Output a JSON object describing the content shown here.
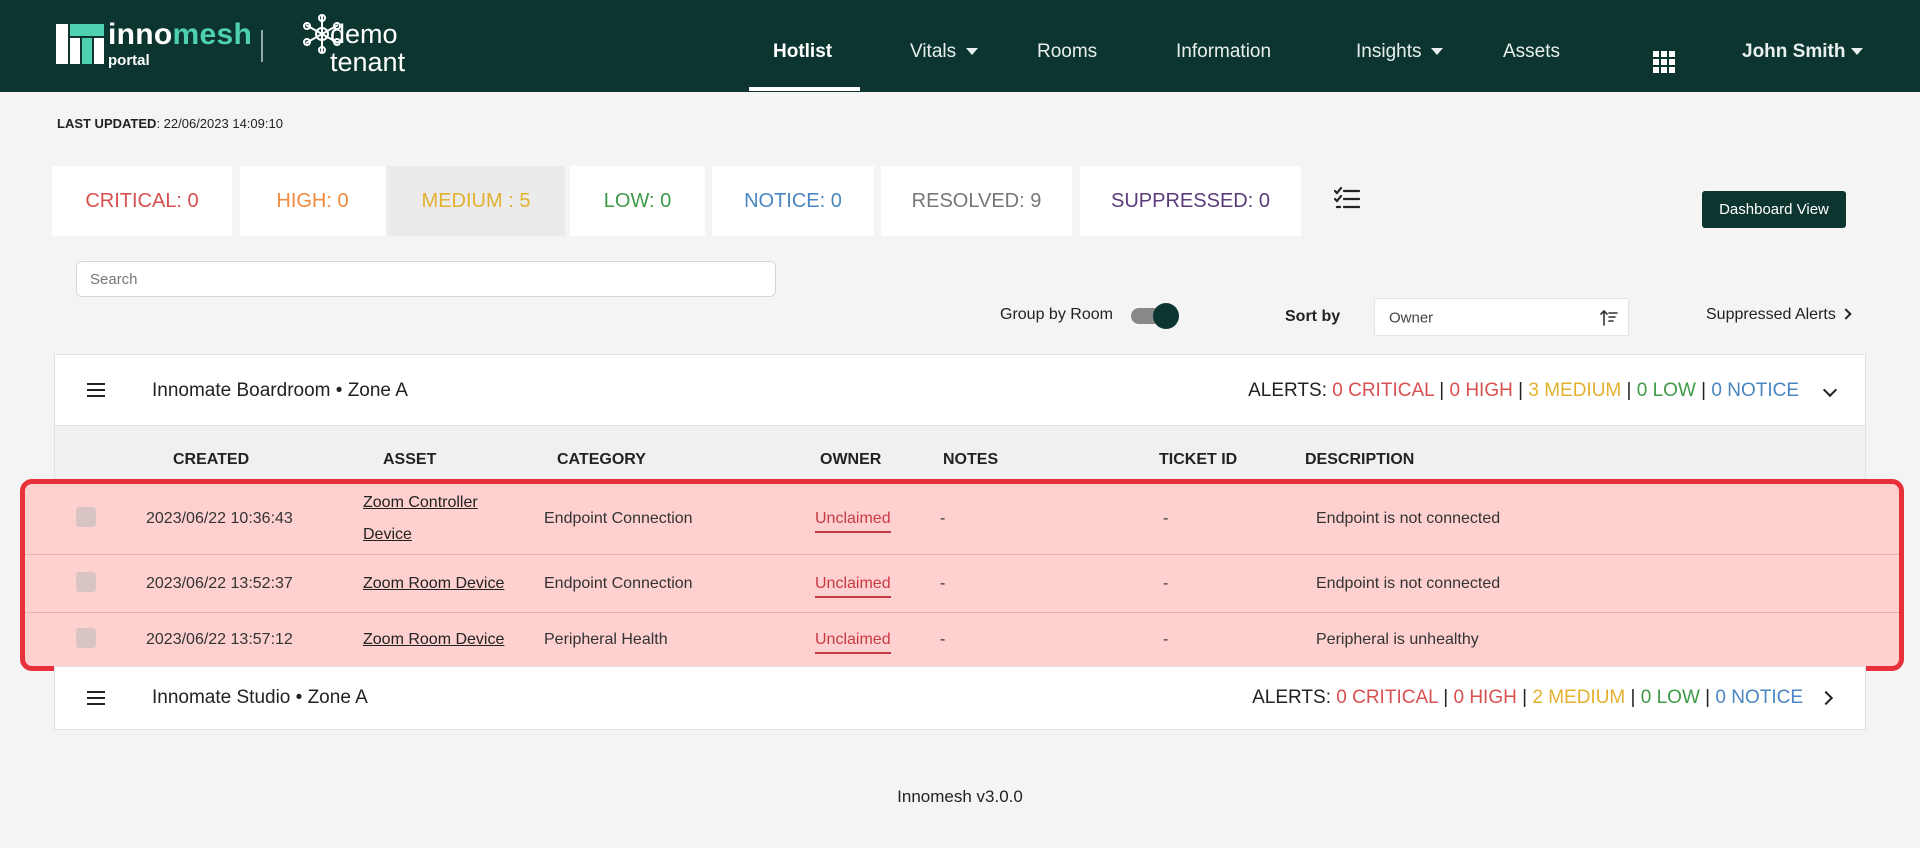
{
  "brand": {
    "logo_word_1": "inno",
    "logo_word_2": "mesh",
    "logo_sub": "portal",
    "tenant_line1": "demo",
    "tenant_line2": "tenant"
  },
  "nav": {
    "items": [
      {
        "label": "Hotlist",
        "active": true
      },
      {
        "label": "Vitals",
        "dropdown": true
      },
      {
        "label": "Rooms"
      },
      {
        "label": "Information"
      },
      {
        "label": "Insights",
        "dropdown": true
      },
      {
        "label": "Assets"
      }
    ],
    "apps_icon": "grid-icon",
    "user": "John Smith"
  },
  "last_updated": {
    "label": "LAST UPDATED",
    "value": ": 22/06/2023 14:09:10"
  },
  "severity_tabs": [
    {
      "label": "CRITICAL: 0",
      "color": "#d8504f"
    },
    {
      "label": "HIGH: 0",
      "color": "#f08a3e"
    },
    {
      "label": "MEDIUM : 5",
      "color": "#e3b02f",
      "selected": true
    },
    {
      "label": "LOW: 0",
      "color": "#3f9a48"
    },
    {
      "label": "NOTICE: 0",
      "color": "#4a86c1"
    },
    {
      "label": "RESOLVED: 9",
      "color": "#777777"
    },
    {
      "label": "SUPPRESSED: 0",
      "color": "#5b3b7a"
    }
  ],
  "dashboard_button": "Dashboard View",
  "search": {
    "placeholder": "Search",
    "value": ""
  },
  "controls": {
    "group_by_label": "Group by Room",
    "group_by_on": true,
    "sort_label": "Sort by",
    "sort_value": "Owner",
    "suppressed_link": "Suppressed Alerts"
  },
  "rooms": [
    {
      "title": "Innomate Boardroom • Zone A",
      "alerts_label": "ALERTS: ",
      "critical": "0 CRITICAL",
      "high": "0 HIGH",
      "medium": "3 MEDIUM",
      "low": "0 LOW",
      "notice": "0 NOTICE",
      "sep": " | ",
      "expanded": true
    },
    {
      "title": "Innomate Studio • Zone A",
      "alerts_label": "ALERTS: ",
      "critical": "0 CRITICAL",
      "high": "0 HIGH",
      "medium": "2 MEDIUM",
      "low": "0 LOW",
      "notice": "0 NOTICE",
      "sep": " | ",
      "expanded": false
    }
  ],
  "table": {
    "columns": [
      "CREATED",
      "ASSET",
      "CATEGORY",
      "OWNER",
      "NOTES",
      "TICKET ID",
      "DESCRIPTION"
    ],
    "rows": [
      {
        "created": "2023/06/22 10:36:43",
        "asset": "Zoom Controller Device",
        "category": "Endpoint Connection",
        "owner": "Unclaimed",
        "notes": "-",
        "ticket": "-",
        "description": "Endpoint is not connected"
      },
      {
        "created": "2023/06/22 13:52:37",
        "asset": "Zoom Room Device",
        "category": "Endpoint Connection",
        "owner": "Unclaimed",
        "notes": "-",
        "ticket": "-",
        "description": "Endpoint is not connected"
      },
      {
        "created": "2023/06/22 13:57:12",
        "asset": "Zoom Room Device",
        "category": "Peripheral Health",
        "owner": "Unclaimed",
        "notes": "-",
        "ticket": "-",
        "description": "Peripheral is unhealthy"
      }
    ]
  },
  "footer": "Innomesh v3.0.0"
}
